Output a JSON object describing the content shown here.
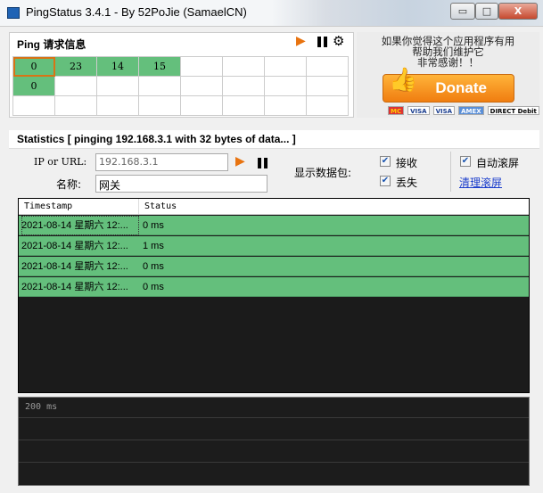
{
  "window": {
    "title": "PingStatus 3.4.1 - By 52PoJie (SamaelCN)",
    "minimize": "▭",
    "maximize": "□",
    "close": "X"
  },
  "ping_panel": {
    "title": "Ping 请求信息",
    "play": "▶",
    "pause": "❚❚",
    "settings": "⚙",
    "cells": [
      [
        "0",
        "23",
        "14",
        "15",
        "",
        "",
        "",
        ""
      ],
      [
        "0",
        "",
        "",
        "",
        "",
        "",
        "",
        ""
      ],
      [
        "",
        "",
        "",
        "",
        "",
        "",
        "",
        ""
      ]
    ]
  },
  "donate": {
    "text": "如果你觉得这个应用程序有用\n帮助我们维护它\n非常感谢！！",
    "button": "Donate",
    "cards": [
      "MC",
      "VISA",
      "VISA",
      "AMEX",
      "DIRECT Debit"
    ]
  },
  "statistics": {
    "title": "Statistics  [ pinging 192.168.3.1 with 32 bytes of data... ]",
    "ip_label": "IP or URL:",
    "ip_value": "192.168.3.1",
    "name_label": "名称:",
    "name_value": "网关",
    "play": "▶",
    "pause": "❚❚",
    "show_packets_label": "显示数据包:",
    "receive_label": "接收",
    "receive_checked": true,
    "lost_label": "丢失",
    "lost_checked": true,
    "autoscroll_label": "自动滚屏",
    "autoscroll_checked": true,
    "clear_link": "清理滚屏"
  },
  "table": {
    "columns": [
      "Timestamp",
      "Status"
    ],
    "rows": [
      {
        "timestamp": "2021-08-14 星期六  12:...",
        "status": "0 ms"
      },
      {
        "timestamp": "2021-08-14 星期六  12:...",
        "status": "1 ms"
      },
      {
        "timestamp": "2021-08-14 星期六  12:...",
        "status": "0 ms"
      },
      {
        "timestamp": "2021-08-14 星期六  12:...",
        "status": "0 ms"
      }
    ]
  },
  "graph": {
    "label": "200 ms"
  },
  "colors": {
    "success": "#64bf7c",
    "accent": "#e8730f",
    "link": "#1a3dcc"
  }
}
